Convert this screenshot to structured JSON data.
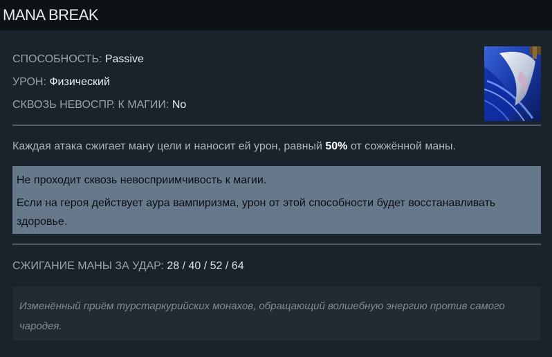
{
  "ability": {
    "title": "MANA BREAK",
    "icon": "mana-break-ability-icon"
  },
  "attributes": {
    "type_label": "СПОСОБНОСТЬ:",
    "type_value": "Passive",
    "damage_label": "УРОН:",
    "damage_value": "Физический",
    "pierce_label": "СКВОЗЬ НЕВОСПР. К МАГИИ:",
    "pierce_value": "No"
  },
  "description": {
    "prefix": "Каждая атака сжигает ману цели и наносит ей урон, равный",
    "highlight": "50%",
    "suffix": "от сожжённой маны."
  },
  "notes": [
    "Не проходит сквозь невосприимчивость к магии.",
    "Если на героя действует аура вампиризма, урон от этой способности будет восстанавливать",
    "здоровье."
  ],
  "mana_burn": {
    "label": "СЖИГАНИЕ МАНЫ ЗА УДАР:",
    "values": "28 / 40 / 52 / 64"
  },
  "lore": "Изменённый приём турстаркурийских монахов, обращающий волшебную энергию против самого чародея.",
  "colors": {
    "background": "#1a232b",
    "title_bar": "#0e1215",
    "note_box": "#66788a",
    "lore_box": "#202b34",
    "divider": "#505c66"
  }
}
